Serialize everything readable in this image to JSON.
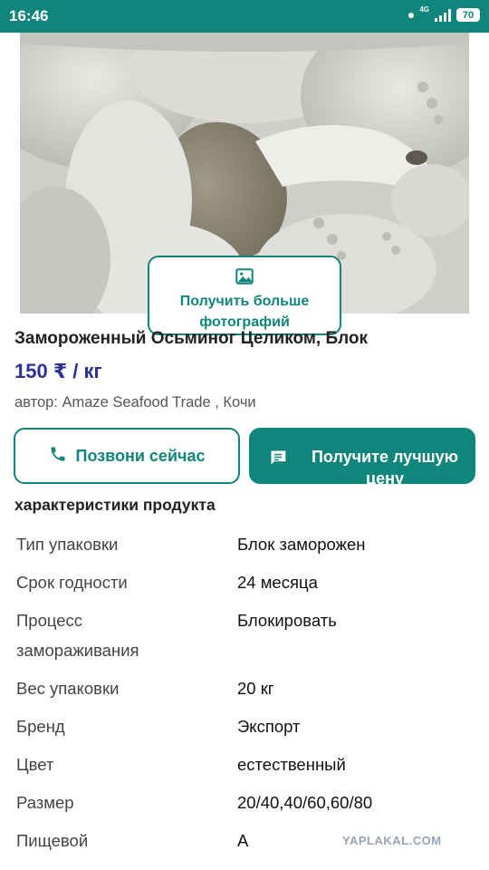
{
  "status_bar": {
    "time": "16:46",
    "network": "4G",
    "battery": "70"
  },
  "gallery": {
    "more_photos_label": "Получить больше фотографий"
  },
  "product": {
    "title": "Замороженный Осьминог Целиком, Блок",
    "price": "150 ₹ / кг",
    "seller": "автор: Amaze Seafood Trade , Кочи"
  },
  "actions": {
    "call_label": "Позвони сейчас",
    "best_price_label": "Получите лучшую цену"
  },
  "specs": {
    "section_title": "характеристики продукта",
    "rows": [
      {
        "key": "Тип упаковки",
        "value": "Блок заморожен"
      },
      {
        "key": "Срок годности",
        "value": "24 месяца"
      },
      {
        "key": "Процесс замораживания",
        "value": "Блокировать"
      },
      {
        "key": "Вес упаковки",
        "value": "20 кг"
      },
      {
        "key": "Бренд",
        "value": "Экспорт"
      },
      {
        "key": "Цвет",
        "value": "естественный"
      },
      {
        "key": "Размер",
        "value": "20/40,40/60,60/80"
      },
      {
        "key": "Пищевой",
        "value": "A"
      }
    ]
  },
  "watermark": "YAPLAKAL.COM",
  "colors": {
    "accent": "#10857b",
    "price": "#2e3192"
  }
}
